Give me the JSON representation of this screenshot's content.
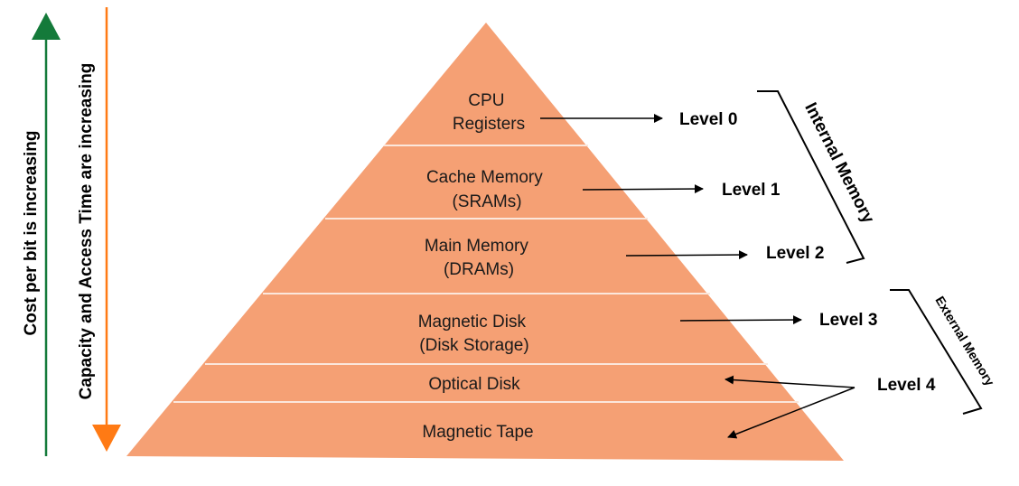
{
  "colors": {
    "pyramid_fill": "#f5a074",
    "separator": "#fbe7dc",
    "green_arrow": "#147a3a",
    "orange_arrow": "#ff7a14",
    "text": "#1a1a1a"
  },
  "axes": {
    "cost_label": "Cost per bit is increasing",
    "capacity_label": "Capacity and Access Time are increasing"
  },
  "tiers": [
    {
      "line1": "CPU",
      "line2": "Registers"
    },
    {
      "line1": "Cache Memory",
      "line2": "(SRAMs)"
    },
    {
      "line1": "Main Memory",
      "line2": "(DRAMs)"
    },
    {
      "line1": "Magnetic Disk",
      "line2": "(Disk Storage)"
    },
    {
      "line1": "Optical Disk"
    },
    {
      "line1": "Magnetic Tape"
    }
  ],
  "levels": [
    "Level 0",
    "Level 1",
    "Level 2",
    "Level 3",
    "Level 4"
  ],
  "brackets": {
    "internal": "Internal Memory",
    "external": "External Memory"
  },
  "icons": {
    "up_arrow": "arrow-up-icon",
    "down_arrow": "arrow-down-icon"
  }
}
